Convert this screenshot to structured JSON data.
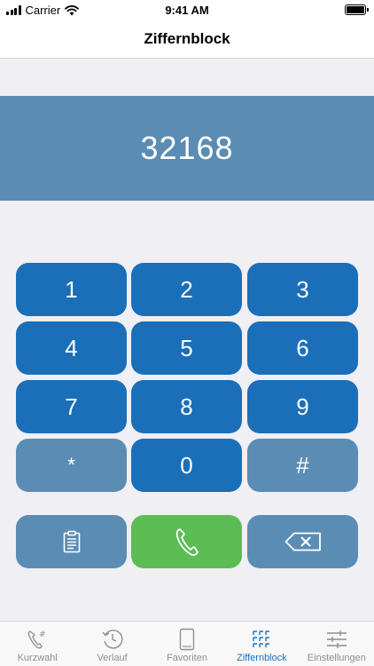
{
  "status_bar": {
    "carrier": "Carrier",
    "time": "9:41 AM"
  },
  "nav": {
    "title": "Ziffernblock"
  },
  "display": {
    "number": "32168"
  },
  "keypad": {
    "keys": [
      "1",
      "2",
      "3",
      "4",
      "5",
      "6",
      "7",
      "8",
      "9",
      "*",
      "0",
      "#"
    ]
  },
  "actions": {
    "paste_icon": "clipboard-icon",
    "call_icon": "phone-icon",
    "delete_icon": "backspace-icon"
  },
  "tabs": [
    {
      "label": "Kurzwahl",
      "icon": "speed-dial-icon"
    },
    {
      "label": "Verlauf",
      "icon": "history-icon"
    },
    {
      "label": "Favoriten",
      "icon": "favorites-icon"
    },
    {
      "label": "Ziffernblock",
      "icon": "keypad-icon",
      "active": true
    },
    {
      "label": "Einstellungen",
      "icon": "settings-sliders-icon"
    }
  ],
  "colors": {
    "key_dark": "#1b6fb8",
    "key_light": "#5b8db4",
    "call_green": "#5cbd55",
    "display_bg": "#5b8db4",
    "active_tab": "#1b6fb8"
  }
}
